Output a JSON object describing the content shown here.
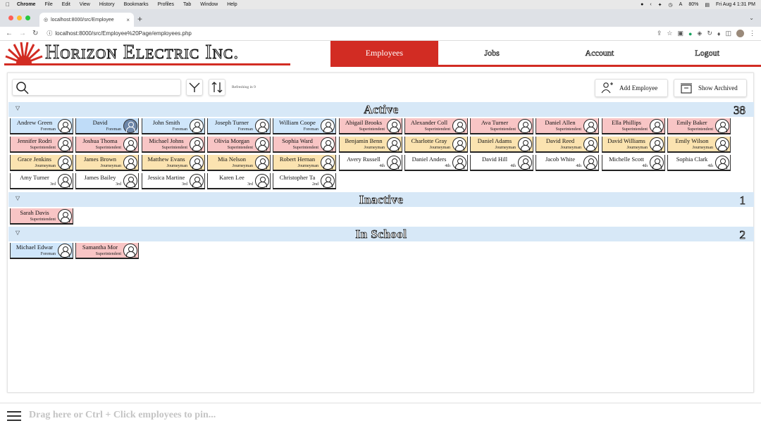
{
  "macos_menu": {
    "app": "Chrome",
    "items": [
      "File",
      "Edit",
      "View",
      "History",
      "Bookmarks",
      "Profiles",
      "Tab",
      "Window",
      "Help"
    ],
    "battery": "80%",
    "datetime": "Fri Aug 4  1:31 PM"
  },
  "browser": {
    "tab_title": "localhost:8000/src/Employee",
    "url": "localhost:8000/src/Employee%20Page/employees.php"
  },
  "header": {
    "brand": "Horizon Electric Inc.",
    "nav": [
      "Employees",
      "Jobs",
      "Account",
      "Logout"
    ],
    "active_nav": "Employees",
    "brand_color": "#d22c23"
  },
  "toolbar": {
    "search_value": "",
    "refresh_text": "Refreshing in 9",
    "add_employee": "Add Employee",
    "show_archived": "Show Archived"
  },
  "sections": [
    {
      "title": "Active",
      "count": "38"
    },
    {
      "title": "Inactive",
      "count": "1"
    },
    {
      "title": "In School",
      "count": "2"
    }
  ],
  "active_rows": [
    [
      {
        "name": "Andrew Green",
        "rank": "Foreman",
        "color": "blue"
      },
      {
        "name": "David",
        "rank": "Foreman",
        "color": "blue",
        "selected": true
      },
      {
        "name": "John Smith",
        "rank": "Foreman",
        "color": "blue"
      },
      {
        "name": "Joseph Turner",
        "rank": "Foreman",
        "color": "blue"
      },
      {
        "name": "William Coope",
        "rank": "Foreman",
        "color": "blue"
      },
      {
        "name": "Abigail Brooks",
        "rank": "Superintendent",
        "color": "pink"
      },
      {
        "name": "Alexander Coll",
        "rank": "Superintendent",
        "color": "pink"
      },
      {
        "name": "Ava Turner",
        "rank": "Superintendent",
        "color": "pink"
      },
      {
        "name": "Daniel Allen",
        "rank": "Superintendent",
        "color": "pink"
      },
      {
        "name": "Ella Phillips",
        "rank": "Superintendent",
        "color": "pink"
      },
      {
        "name": "Emily Baker",
        "rank": "Superintendent",
        "color": "pink"
      }
    ],
    [
      {
        "name": "Jennifer Rodri",
        "rank": "Superintendent",
        "color": "pink"
      },
      {
        "name": "Joshua Thoma",
        "rank": "Superintendent",
        "color": "pink"
      },
      {
        "name": "Michael Johns",
        "rank": "Superintendent",
        "color": "pink"
      },
      {
        "name": "Olivia Morgan",
        "rank": "Superintendent",
        "color": "pink"
      },
      {
        "name": "Sophia Ward",
        "rank": "Superintendent",
        "color": "pink"
      },
      {
        "name": "Benjamin Benn",
        "rank": "Journeyman",
        "color": "yellow"
      },
      {
        "name": "Charlotte Gray",
        "rank": "Journeyman",
        "color": "yellow"
      },
      {
        "name": "Daniel Adams",
        "rank": "Journeyman",
        "color": "yellow"
      },
      {
        "name": "David Reed",
        "rank": "Journeyman",
        "color": "yellow"
      },
      {
        "name": "David Williams",
        "rank": "Journeyman",
        "color": "yellow"
      },
      {
        "name": "Emily Wilson",
        "rank": "Journeyman",
        "color": "yellow"
      }
    ],
    [
      {
        "name": "Grace Jenkins",
        "rank": "Journeyman",
        "color": "yellow"
      },
      {
        "name": "James Brown",
        "rank": "Journeyman",
        "color": "yellow"
      },
      {
        "name": "Matthew Evans",
        "rank": "Journeyman",
        "color": "yellow"
      },
      {
        "name": "Mia Nelson",
        "rank": "Journeyman",
        "color": "yellow"
      },
      {
        "name": "Robert Hernan",
        "rank": "Journeyman",
        "color": "yellow"
      },
      {
        "name": "Avery Russell",
        "rank": "4th",
        "color": "white"
      },
      {
        "name": "Daniel Anders",
        "rank": "4th",
        "color": "white"
      },
      {
        "name": "David Hill",
        "rank": "4th",
        "color": "white"
      },
      {
        "name": "Jacob White",
        "rank": "4th",
        "color": "white"
      },
      {
        "name": "Michelle Scott",
        "rank": "4th",
        "color": "white"
      },
      {
        "name": "Sophia Clark",
        "rank": "4th",
        "color": "white"
      }
    ],
    [
      {
        "name": "Amy Turner",
        "rank": "3rd",
        "color": "white"
      },
      {
        "name": "James Bailey",
        "rank": "3rd",
        "color": "white"
      },
      {
        "name": "Jessica Martine",
        "rank": "3rd",
        "color": "white"
      },
      {
        "name": "Karen Lee",
        "rank": "3rd",
        "color": "white"
      },
      {
        "name": "Christopher Ta",
        "rank": "2nd",
        "color": "white"
      }
    ]
  ],
  "inactive": [
    {
      "name": "Sarah Davis",
      "rank": "Superintendent",
      "color": "pink"
    }
  ],
  "in_school": [
    {
      "name": "Michael Edwar",
      "rank": "Foreman",
      "color": "blue"
    },
    {
      "name": "Samantha Mor",
      "rank": "Superintendent",
      "color": "pink"
    }
  ],
  "pinbar": {
    "hint": "Drag here or Ctrl + Click employees to pin..."
  }
}
